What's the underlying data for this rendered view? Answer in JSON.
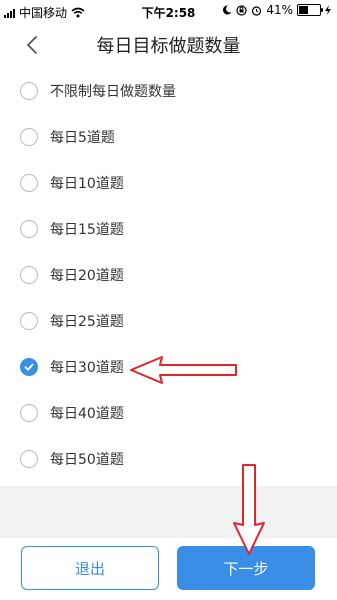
{
  "status_bar": {
    "carrier": "中国移动",
    "time": "下午2:58",
    "battery_percent": "41%"
  },
  "nav": {
    "title": "每日目标做题数量",
    "back_icon": "chevron-left-icon"
  },
  "options": [
    {
      "label": "不限制每日做题数量",
      "checked": false
    },
    {
      "label": "每日5道题",
      "checked": false
    },
    {
      "label": "每日10道题",
      "checked": false
    },
    {
      "label": "每日15道题",
      "checked": false
    },
    {
      "label": "每日20道题",
      "checked": false
    },
    {
      "label": "每日25道题",
      "checked": false
    },
    {
      "label": "每日30道题",
      "checked": true
    },
    {
      "label": "每日40道题",
      "checked": false
    },
    {
      "label": "每日50道题",
      "checked": false
    }
  ],
  "buttons": {
    "exit_label": "退出",
    "next_label": "下一步"
  },
  "colors": {
    "accent": "#3a8ee6",
    "annotation_red": "#e0262b"
  }
}
